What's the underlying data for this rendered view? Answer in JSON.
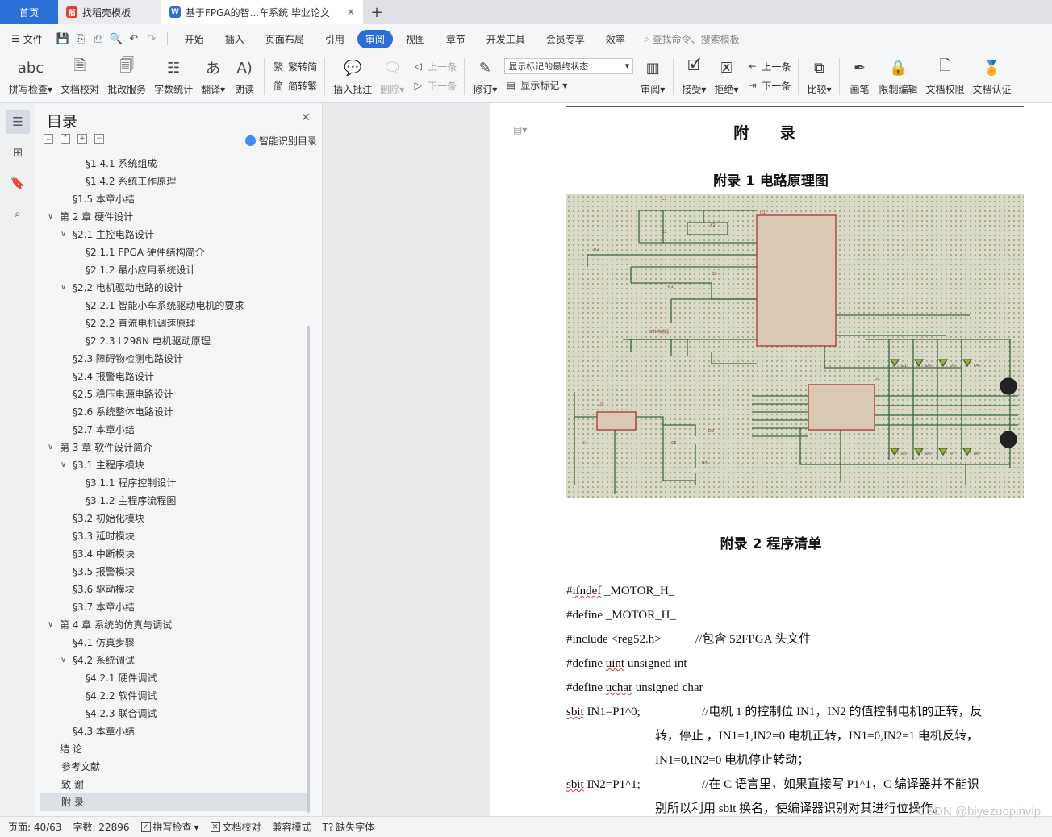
{
  "tabs": {
    "home": "首页",
    "template": "找稻壳模板",
    "doc": "基于FPGA的智...车系统 毕业论文"
  },
  "menu": {
    "file": "文件",
    "items": [
      "开始",
      "插入",
      "页面布局",
      "引用",
      "审阅",
      "视图",
      "章节",
      "开发工具",
      "会员专享",
      "效率"
    ],
    "active_index": 4,
    "search_placeholder": "查找命令、搜索模板"
  },
  "ribbon": {
    "spellcheck": "拼写检查",
    "doc_check": "文档校对",
    "annotate_service": "批改服务",
    "word_count": "字数统计",
    "translate": "翻译",
    "read_aloud": "朗读",
    "trad": "繁转简",
    "simp": "简转繁",
    "insert_comment": "插入批注",
    "delete": "删除",
    "prev": "上一条",
    "next": "下一条",
    "revise": "修订",
    "markup_state": "显示标记的最终状态",
    "show_markup": "显示标记",
    "review": "审阅",
    "accept": "接受",
    "reject": "拒绝",
    "prev2": "上一条",
    "next2": "下一条",
    "compare": "比较",
    "pen": "画笔",
    "restrict": "限制编辑",
    "permission": "文档权限",
    "certify": "文档认证"
  },
  "toc": {
    "title": "目录",
    "smart": "智能识别目录",
    "items": [
      {
        "text": "§1.4.1  系统组成",
        "level": 3
      },
      {
        "text": "§1.4.2  系统工作原理",
        "level": 3
      },
      {
        "text": "§1.5  本章小结",
        "level": 2
      },
      {
        "text": "第 2 章  硬件设计",
        "level": 1,
        "expanded": true
      },
      {
        "text": "§2.1  主控电路设计",
        "level": 2,
        "expanded": true
      },
      {
        "text": "§2.1.1  FPGA 硬件结构简介",
        "level": 3
      },
      {
        "text": "§2.1.2  最小应用系统设计",
        "level": 3
      },
      {
        "text": "§2.2  电机驱动电路的设计",
        "level": 2,
        "expanded": true
      },
      {
        "text": "§2.2.1  智能小车系统驱动电机的要求",
        "level": 3
      },
      {
        "text": "§2.2.2  直流电机调速原理",
        "level": 3
      },
      {
        "text": "§2.2.3  L298N 电机驱动原理",
        "level": 3
      },
      {
        "text": "§2.3  障碍物检测电路设计",
        "level": 2
      },
      {
        "text": "§2.4  报警电路设计",
        "level": 2
      },
      {
        "text": "§2.5  稳压电源电路设计",
        "level": 2
      },
      {
        "text": "§2.6  系统整体电路设计",
        "level": 2
      },
      {
        "text": "§2.7  本章小结",
        "level": 2
      },
      {
        "text": "第 3 章  软件设计简介",
        "level": 1,
        "expanded": true
      },
      {
        "text": "§3.1  主程序模块",
        "level": 2,
        "expanded": true
      },
      {
        "text": "§3.1.1  程序控制设计",
        "level": 3
      },
      {
        "text": "§3.1.2  主程序流程图",
        "level": 3
      },
      {
        "text": "§3.2  初始化模块",
        "level": 2
      },
      {
        "text": "§3.3  延时模块",
        "level": 2
      },
      {
        "text": "§3.4  中断模块",
        "level": 2
      },
      {
        "text": "§3.5  报警模块",
        "level": 2
      },
      {
        "text": "§3.6  驱动模块",
        "level": 2
      },
      {
        "text": "§3.7  本章小结",
        "level": 2
      },
      {
        "text": "第 4 章  系统的仿真与调试",
        "level": 1,
        "expanded": true
      },
      {
        "text": "§4.1  仿真步骤",
        "level": 2
      },
      {
        "text": "§4.2  系统调试",
        "level": 2,
        "expanded": true
      },
      {
        "text": "§4.2.1  硬件调试",
        "level": 3
      },
      {
        "text": "§4.2.2  软件调试",
        "level": 3
      },
      {
        "text": "§4.2.3  联合调试",
        "level": 3
      },
      {
        "text": "§4.3  本章小结",
        "level": 2
      },
      {
        "text": "结    论",
        "level": 1
      },
      {
        "text": "参考文献",
        "level": 0
      },
      {
        "text": "致    谢",
        "level": 0
      },
      {
        "text": "附    录",
        "level": 0,
        "selected": true
      }
    ]
  },
  "document": {
    "appendix_title": "附 录",
    "appendix1": "附录 1  电路原理图",
    "appendix2": "附录 2  程序清单",
    "code": [
      {
        "segments": [
          [
            "#",
            ""
          ],
          [
            "ifndef",
            "wavy"
          ],
          [
            " _MOTOR_H_",
            ""
          ]
        ]
      },
      {
        "segments": [
          [
            "#define _MOTOR_H_",
            ""
          ]
        ]
      },
      {
        "segments": [
          [
            "#include <reg52.h>",
            ""
          ]
        ],
        "comment": "//包含 52FPGA 头文件"
      },
      {
        "segments": [
          [
            "#define ",
            ""
          ],
          [
            "uint",
            "wavy"
          ],
          [
            " unsigned int",
            ""
          ]
        ]
      },
      {
        "segments": [
          [
            "#define ",
            ""
          ],
          [
            "uchar",
            "wavy"
          ],
          [
            " unsigned char",
            ""
          ]
        ]
      },
      {
        "segments": [
          [
            "sbit",
            "wavy"
          ],
          [
            " IN1=P1^0;",
            ""
          ]
        ],
        "comment": "//电机 1 的控制位  IN1，IN2 的值控制电机的正转，反"
      },
      {
        "segments": [
          [
            "",
            ""
          ]
        ],
        "comment": "转，停止   ，IN1=1,IN2=0 电机正转，IN1=0,IN2=1 电机反转，",
        "indent": true
      },
      {
        "segments": [
          [
            "",
            ""
          ]
        ],
        "comment": "IN1=0,IN2=0 电机停止转动；",
        "indent": true
      },
      {
        "segments": [
          [
            "sbit",
            "wavy"
          ],
          [
            " IN2=P1^1;",
            ""
          ]
        ],
        "comment": "//在 C 语言里，如果直接写 P1^1，C 编译器并不能识"
      },
      {
        "segments": [
          [
            "",
            ""
          ]
        ],
        "comment": "别所以利用 sbit 换名，使编译器识别对其进行位操作。",
        "indent": true
      }
    ]
  },
  "status": {
    "page": "页面: 40/63",
    "words": "字数: 22896",
    "spell": "拼写检查",
    "doc_check": "文档校对",
    "compat": "兼容模式",
    "missing_font": "缺失字体"
  },
  "watermark": "CSDN @biyezuopinvip"
}
